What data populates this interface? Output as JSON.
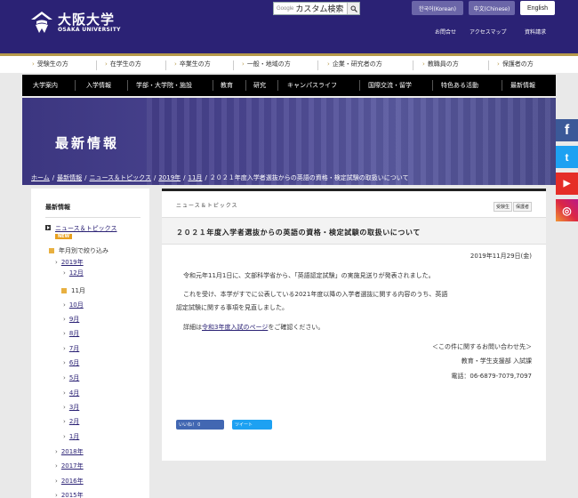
{
  "header": {
    "logo_jp": "大阪大学",
    "logo_en": "OSAKA UNIVERSITY",
    "search_google": "Google",
    "search_value": "カスタム検索",
    "lang_ko": "한국어(Korean)",
    "lang_zh": "中文(Chinese)",
    "lang_en": "English",
    "util_links": [
      "お問合せ",
      "アクセスマップ",
      "資料請求"
    ]
  },
  "audience_nav": [
    "受験生の方",
    "在学生の方",
    "卒業生の方",
    "一般・地域の方",
    "企業・研究者の方",
    "教職員の方",
    "保護者の方"
  ],
  "main_nav": [
    "大学案内",
    "入学情報",
    "学部・大学院・施設",
    "教育",
    "研究",
    "キャンパスライフ",
    "国際交流・留学",
    "特色ある活動",
    "最新情報"
  ],
  "hero": {
    "title": "最新情報",
    "breadcrumb": [
      "ホーム",
      "最新情報",
      "ニュース＆トピックス",
      "2019年",
      "11月"
    ],
    "breadcrumb_current": "２０２１年度入学者選抜からの英語の資格・検定試験の取扱いについて"
  },
  "social": {
    "facebook": "f",
    "twitter": "t",
    "youtube": "▶",
    "instagram": "◎"
  },
  "sidebar": {
    "title": "最新情報",
    "news_link": "ニュース＆トピックス",
    "new_badge": "NEW",
    "filter_label": "年月別で絞り込み",
    "year_2019": "2019年",
    "months": [
      "12月",
      "11月",
      "10月",
      "9月",
      "8月",
      "7月",
      "6月",
      "5月",
      "4月",
      "3月",
      "2月",
      "1月"
    ],
    "years": [
      "2018年",
      "2017年",
      "2016年",
      "2015年"
    ]
  },
  "article": {
    "category": "ニュース＆トピックス",
    "tags": [
      "受験生",
      "保護者"
    ],
    "title": "２０２１年度入学者選抜からの英語の資格・検定試験の取扱いについて",
    "date": "2019年11月29日(金)",
    "p1": "令和元年11月1日に、文部科学省から、「英語認定試験」の実施見送りが発表されました。",
    "p2a": "これを受け、本学がすでに公表している2021年度以降の入学者選抜に関する内容のうち、英語",
    "p2b": "認定試験に関する事項を見直しました。",
    "p3_pre": "詳細は",
    "p3_link": "令和3年度入試のページ",
    "p3_post": "をご確認ください。",
    "contact_head": "＜この件に関するお問い合わせ先＞",
    "contact_dept": "教育・学生支援部 入試課",
    "contact_tel": "電話：06-6879-7079,7097",
    "like_label": "いいね！ 0",
    "tweet_label": "ツイート"
  }
}
